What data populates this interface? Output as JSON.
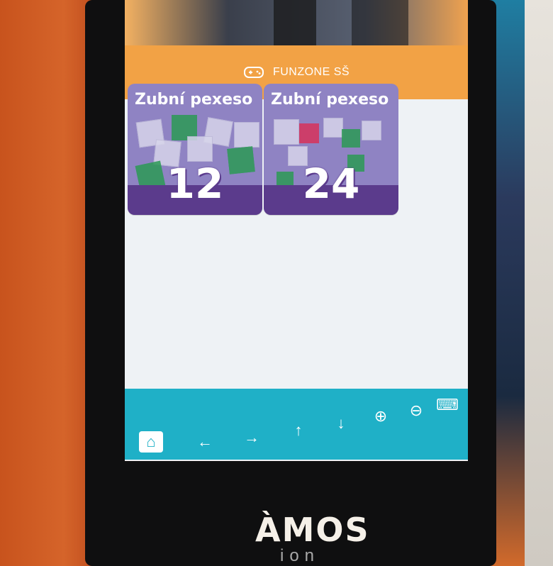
{
  "header": {
    "icon": "gamepad-icon",
    "title": "FUNZONE SŠ"
  },
  "tiles": [
    {
      "title": "Zubní pexeso",
      "number": "12"
    },
    {
      "title": "Zubní pexeso",
      "number": "24"
    }
  ],
  "toolbar": {
    "home_icon": "home-icon",
    "left_icon": "arrow-left-icon",
    "right_icon": "arrow-right-icon",
    "up_icon": "arrow-up-icon",
    "down_icon": "arrow-down-icon",
    "zoom_in_icon": "zoom-in-icon",
    "zoom_out_icon": "zoom-out-icon",
    "keyboard_icon": "keyboard-icon"
  },
  "brand": {
    "name": "ÀMOS",
    "sub": "ion"
  },
  "colors": {
    "header": "#f2a245",
    "toolbar": "#1fb0c7",
    "tile": "#8f83c3",
    "tile_band": "#5b3b8c"
  }
}
